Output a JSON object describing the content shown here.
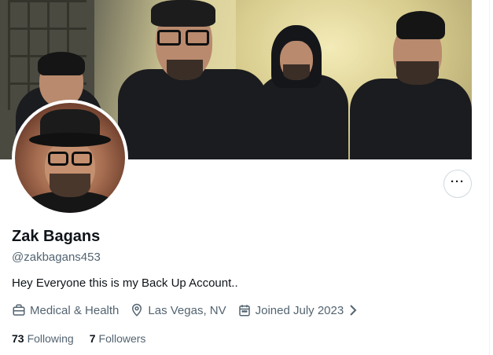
{
  "profile": {
    "name": "Zak Bagans",
    "handle": "@zakbagans453",
    "bio": "Hey Everyone this is my Back Up Account..",
    "category": "Medical & Health",
    "location": "Las Vegas, NV",
    "joined": "Joined July 2023",
    "following_count": "73",
    "following_label": "Following",
    "followers_count": "7",
    "followers_label": "Followers"
  },
  "actions": {
    "more_label": "···"
  },
  "icons": {
    "category": "briefcase-icon",
    "location": "location-pin-icon",
    "joined": "calendar-icon",
    "expand": "chevron-right-icon",
    "more": "more-horizontal-icon"
  },
  "colors": {
    "text_primary": "#0f1419",
    "text_secondary": "#536471",
    "border": "#cfd9de"
  }
}
